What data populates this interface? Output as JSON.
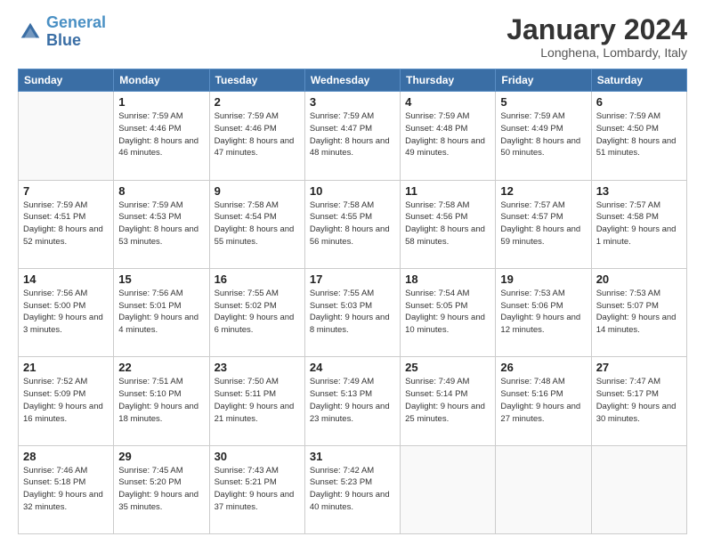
{
  "header": {
    "logo_general": "General",
    "logo_blue": "Blue",
    "month_title": "January 2024",
    "subtitle": "Longhena, Lombardy, Italy"
  },
  "days_of_week": [
    "Sunday",
    "Monday",
    "Tuesday",
    "Wednesday",
    "Thursday",
    "Friday",
    "Saturday"
  ],
  "weeks": [
    [
      {
        "day": "",
        "sunrise": "",
        "sunset": "",
        "daylight": "",
        "empty": true
      },
      {
        "day": "1",
        "sunrise": "Sunrise: 7:59 AM",
        "sunset": "Sunset: 4:46 PM",
        "daylight": "Daylight: 8 hours and 46 minutes."
      },
      {
        "day": "2",
        "sunrise": "Sunrise: 7:59 AM",
        "sunset": "Sunset: 4:46 PM",
        "daylight": "Daylight: 8 hours and 47 minutes."
      },
      {
        "day": "3",
        "sunrise": "Sunrise: 7:59 AM",
        "sunset": "Sunset: 4:47 PM",
        "daylight": "Daylight: 8 hours and 48 minutes."
      },
      {
        "day": "4",
        "sunrise": "Sunrise: 7:59 AM",
        "sunset": "Sunset: 4:48 PM",
        "daylight": "Daylight: 8 hours and 49 minutes."
      },
      {
        "day": "5",
        "sunrise": "Sunrise: 7:59 AM",
        "sunset": "Sunset: 4:49 PM",
        "daylight": "Daylight: 8 hours and 50 minutes."
      },
      {
        "day": "6",
        "sunrise": "Sunrise: 7:59 AM",
        "sunset": "Sunset: 4:50 PM",
        "daylight": "Daylight: 8 hours and 51 minutes."
      }
    ],
    [
      {
        "day": "7",
        "sunrise": "Sunrise: 7:59 AM",
        "sunset": "Sunset: 4:51 PM",
        "daylight": "Daylight: 8 hours and 52 minutes."
      },
      {
        "day": "8",
        "sunrise": "Sunrise: 7:59 AM",
        "sunset": "Sunset: 4:53 PM",
        "daylight": "Daylight: 8 hours and 53 minutes."
      },
      {
        "day": "9",
        "sunrise": "Sunrise: 7:58 AM",
        "sunset": "Sunset: 4:54 PM",
        "daylight": "Daylight: 8 hours and 55 minutes."
      },
      {
        "day": "10",
        "sunrise": "Sunrise: 7:58 AM",
        "sunset": "Sunset: 4:55 PM",
        "daylight": "Daylight: 8 hours and 56 minutes."
      },
      {
        "day": "11",
        "sunrise": "Sunrise: 7:58 AM",
        "sunset": "Sunset: 4:56 PM",
        "daylight": "Daylight: 8 hours and 58 minutes."
      },
      {
        "day": "12",
        "sunrise": "Sunrise: 7:57 AM",
        "sunset": "Sunset: 4:57 PM",
        "daylight": "Daylight: 8 hours and 59 minutes."
      },
      {
        "day": "13",
        "sunrise": "Sunrise: 7:57 AM",
        "sunset": "Sunset: 4:58 PM",
        "daylight": "Daylight: 9 hours and 1 minute."
      }
    ],
    [
      {
        "day": "14",
        "sunrise": "Sunrise: 7:56 AM",
        "sunset": "Sunset: 5:00 PM",
        "daylight": "Daylight: 9 hours and 3 minutes."
      },
      {
        "day": "15",
        "sunrise": "Sunrise: 7:56 AM",
        "sunset": "Sunset: 5:01 PM",
        "daylight": "Daylight: 9 hours and 4 minutes."
      },
      {
        "day": "16",
        "sunrise": "Sunrise: 7:55 AM",
        "sunset": "Sunset: 5:02 PM",
        "daylight": "Daylight: 9 hours and 6 minutes."
      },
      {
        "day": "17",
        "sunrise": "Sunrise: 7:55 AM",
        "sunset": "Sunset: 5:03 PM",
        "daylight": "Daylight: 9 hours and 8 minutes."
      },
      {
        "day": "18",
        "sunrise": "Sunrise: 7:54 AM",
        "sunset": "Sunset: 5:05 PM",
        "daylight": "Daylight: 9 hours and 10 minutes."
      },
      {
        "day": "19",
        "sunrise": "Sunrise: 7:53 AM",
        "sunset": "Sunset: 5:06 PM",
        "daylight": "Daylight: 9 hours and 12 minutes."
      },
      {
        "day": "20",
        "sunrise": "Sunrise: 7:53 AM",
        "sunset": "Sunset: 5:07 PM",
        "daylight": "Daylight: 9 hours and 14 minutes."
      }
    ],
    [
      {
        "day": "21",
        "sunrise": "Sunrise: 7:52 AM",
        "sunset": "Sunset: 5:09 PM",
        "daylight": "Daylight: 9 hours and 16 minutes."
      },
      {
        "day": "22",
        "sunrise": "Sunrise: 7:51 AM",
        "sunset": "Sunset: 5:10 PM",
        "daylight": "Daylight: 9 hours and 18 minutes."
      },
      {
        "day": "23",
        "sunrise": "Sunrise: 7:50 AM",
        "sunset": "Sunset: 5:11 PM",
        "daylight": "Daylight: 9 hours and 21 minutes."
      },
      {
        "day": "24",
        "sunrise": "Sunrise: 7:49 AM",
        "sunset": "Sunset: 5:13 PM",
        "daylight": "Daylight: 9 hours and 23 minutes."
      },
      {
        "day": "25",
        "sunrise": "Sunrise: 7:49 AM",
        "sunset": "Sunset: 5:14 PM",
        "daylight": "Daylight: 9 hours and 25 minutes."
      },
      {
        "day": "26",
        "sunrise": "Sunrise: 7:48 AM",
        "sunset": "Sunset: 5:16 PM",
        "daylight": "Daylight: 9 hours and 27 minutes."
      },
      {
        "day": "27",
        "sunrise": "Sunrise: 7:47 AM",
        "sunset": "Sunset: 5:17 PM",
        "daylight": "Daylight: 9 hours and 30 minutes."
      }
    ],
    [
      {
        "day": "28",
        "sunrise": "Sunrise: 7:46 AM",
        "sunset": "Sunset: 5:18 PM",
        "daylight": "Daylight: 9 hours and 32 minutes."
      },
      {
        "day": "29",
        "sunrise": "Sunrise: 7:45 AM",
        "sunset": "Sunset: 5:20 PM",
        "daylight": "Daylight: 9 hours and 35 minutes."
      },
      {
        "day": "30",
        "sunrise": "Sunrise: 7:43 AM",
        "sunset": "Sunset: 5:21 PM",
        "daylight": "Daylight: 9 hours and 37 minutes."
      },
      {
        "day": "31",
        "sunrise": "Sunrise: 7:42 AM",
        "sunset": "Sunset: 5:23 PM",
        "daylight": "Daylight: 9 hours and 40 minutes."
      },
      {
        "day": "",
        "sunrise": "",
        "sunset": "",
        "daylight": "",
        "empty": true
      },
      {
        "day": "",
        "sunrise": "",
        "sunset": "",
        "daylight": "",
        "empty": true
      },
      {
        "day": "",
        "sunrise": "",
        "sunset": "",
        "daylight": "",
        "empty": true
      }
    ]
  ]
}
